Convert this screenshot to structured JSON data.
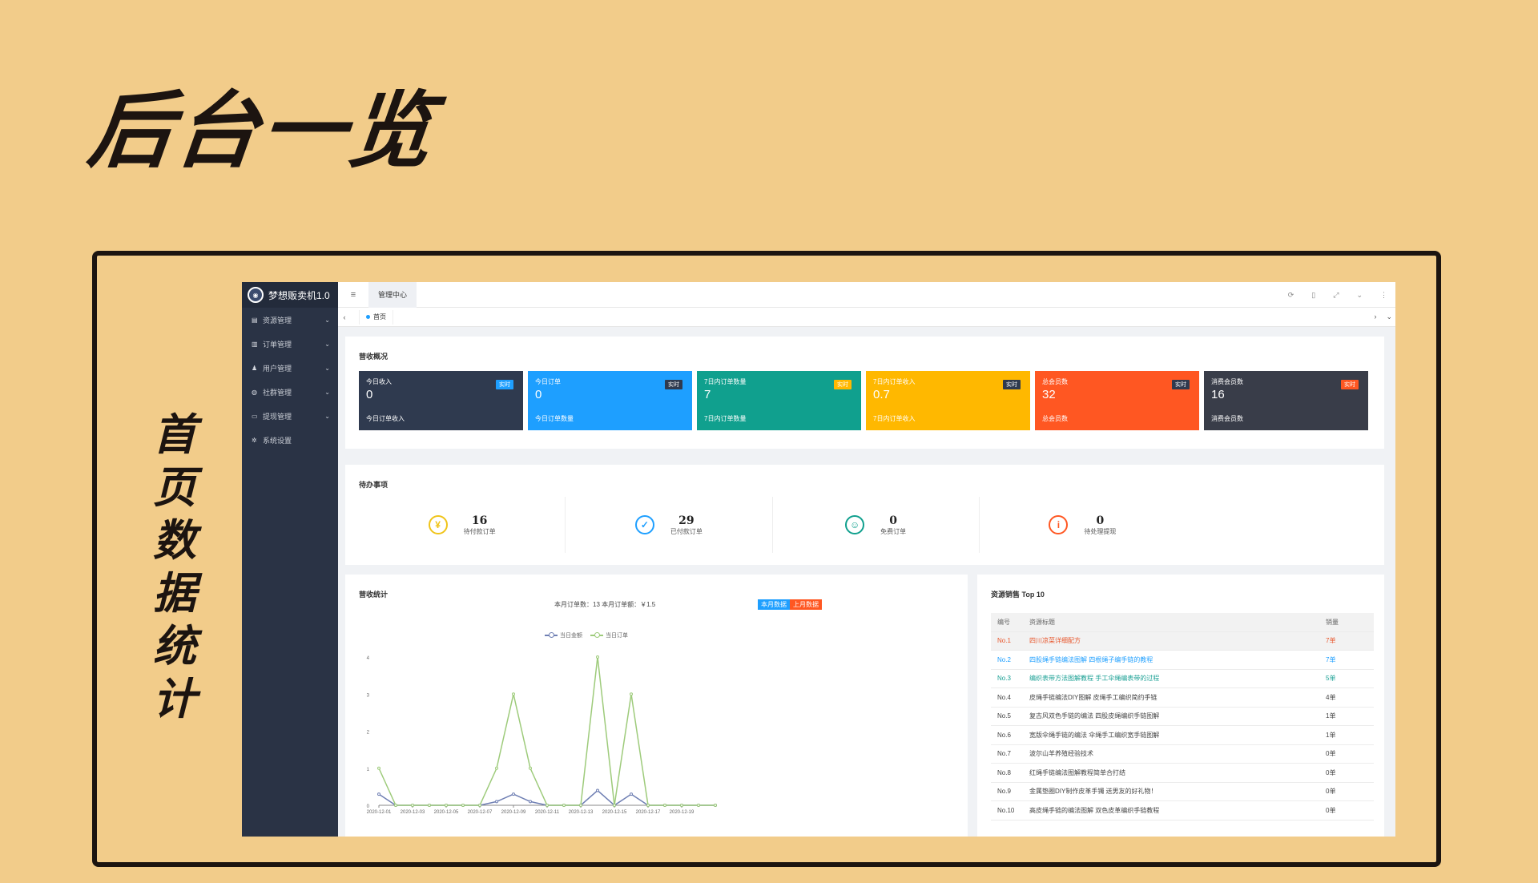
{
  "hero_title": "后台一览",
  "side_caption": [
    "首",
    "页",
    "数",
    "据",
    "统",
    "计"
  ],
  "app": {
    "brand": "梦想贩卖机1.0",
    "sidebar": [
      {
        "label": "资源管理",
        "icon": "file-icon",
        "glyph": "▤",
        "chevron": "⌄"
      },
      {
        "label": "订单管理",
        "icon": "cart-icon",
        "glyph": "▥",
        "chevron": "⌄"
      },
      {
        "label": "用户管理",
        "icon": "users-icon",
        "glyph": "♟",
        "chevron": "⌄"
      },
      {
        "label": "社群管理",
        "icon": "chat-icon",
        "glyph": "◍",
        "chevron": "⌄"
      },
      {
        "label": "提现管理",
        "icon": "card-icon",
        "glyph": "▭",
        "chevron": "⌄"
      },
      {
        "label": "系统设置",
        "icon": "gear-icon",
        "glyph": "✲",
        "chevron": ""
      }
    ],
    "top_tab": "管理中心",
    "home_tab": "首页",
    "icons": {
      "menu": "≡",
      "refresh": "⟳",
      "trash": "🗑",
      "expand": "⤢",
      "dropdown": "⌄",
      "more": "⋮",
      "left": "‹",
      "right": "›"
    }
  },
  "revenue_overview": {
    "title": "营收概况",
    "cards": [
      {
        "name": "今日收入",
        "value": "0",
        "sub": "今日订单收入",
        "badge": "实时",
        "bg": "#2f3a4f",
        "badge_bg": "#1e9fff"
      },
      {
        "name": "今日订单",
        "value": "0",
        "sub": "今日订单数量",
        "badge": "实时",
        "bg": "#1e9fff",
        "badge_bg": "#2f3a4f"
      },
      {
        "name": "7日内订单数量",
        "value": "7",
        "sub": "7日内订单数量",
        "badge": "实时",
        "bg": "#10a08e",
        "badge_bg": "#ffb800"
      },
      {
        "name": "7日内订单收入",
        "value": "0.7",
        "sub": "7日内订单收入",
        "badge": "实时",
        "bg": "#ffb800",
        "badge_bg": "#2f3a4f"
      },
      {
        "name": "总会员数",
        "value": "32",
        "sub": "总会员数",
        "badge": "实时",
        "bg": "#ff5722",
        "badge_bg": "#2f3a4f"
      },
      {
        "name": "消费会员数",
        "value": "16",
        "sub": "消费会员数",
        "badge": "实时",
        "bg": "#393d49",
        "badge_bg": "#ff5722"
      }
    ]
  },
  "todo": {
    "title": "待办事项",
    "items": [
      {
        "icon": "yen-icon",
        "glyph": "¥",
        "color": "#f0c419",
        "value": "16",
        "label": "待付款订单"
      },
      {
        "icon": "shield-icon",
        "glyph": "✓",
        "color": "#1e9fff",
        "value": "29",
        "label": "已付款订单"
      },
      {
        "icon": "smile-icon",
        "glyph": "☺",
        "color": "#10a08e",
        "value": "0",
        "label": "免费订单"
      },
      {
        "icon": "info-icon",
        "glyph": "i",
        "color": "#ff5722",
        "value": "0",
        "label": "待处理提现"
      }
    ]
  },
  "stats": {
    "title": "营收统计",
    "info": "本月订单数：13    本月订单额：￥1.5",
    "btn_this_month": "本月数据",
    "btn_last_month": "上月数据",
    "legend": [
      "当日金额",
      "当日订单"
    ]
  },
  "chart_data": {
    "type": "line",
    "x": [
      "2020-12-01",
      "2020-12-02",
      "2020-12-03",
      "2020-12-04",
      "2020-12-05",
      "2020-12-06",
      "2020-12-07",
      "2020-12-08",
      "2020-12-09",
      "2020-12-10",
      "2020-12-11",
      "2020-12-12",
      "2020-12-13",
      "2020-12-14",
      "2020-12-15",
      "2020-12-16",
      "2020-12-17",
      "2020-12-18",
      "2020-12-19",
      "2020-12-20",
      "2020-12-21"
    ],
    "x_tick_labels": [
      "2020-12-01",
      "2020-12-03",
      "2020-12-05",
      "2020-12-07",
      "2020-12-09",
      "2020-12-11",
      "2020-12-13",
      "2020-12-15",
      "2020-12-17",
      "2020-12-19"
    ],
    "y_ticks": [
      0,
      1,
      2,
      3,
      4
    ],
    "ylim": [
      0,
      4
    ],
    "series": [
      {
        "name": "当日金额",
        "color": "#6f7fb3",
        "values": [
          0.3,
          0,
          0,
          0,
          0,
          0,
          0,
          0.1,
          0.3,
          0.1,
          0,
          0,
          0,
          0.4,
          0,
          0.3,
          0,
          0,
          0,
          0,
          0
        ]
      },
      {
        "name": "当日订单",
        "color": "#9ecb7b",
        "values": [
          1,
          0,
          0,
          0,
          0,
          0,
          0,
          1,
          3,
          1,
          0,
          0,
          0,
          4,
          0,
          3,
          0,
          0,
          0,
          0,
          0
        ]
      }
    ],
    "grid": false
  },
  "top10": {
    "title": "资源销售 Top 10",
    "headers": [
      "编号",
      "资源标题",
      "销量"
    ],
    "rows": [
      {
        "no": "No.1",
        "title": "四川凉菜详细配方",
        "sales": "7单",
        "cls": "t-red",
        "hl": true
      },
      {
        "no": "No.2",
        "title": "四股绳手链编法图解 四根绳子编手链的教程",
        "sales": "7单",
        "cls": "t-blue",
        "hl": false
      },
      {
        "no": "No.3",
        "title": "编织表带方法图解教程 手工伞绳编表带的过程",
        "sales": "5单",
        "cls": "t-teal",
        "hl": false
      },
      {
        "no": "No.4",
        "title": "皮绳手链编法DIY图解 皮绳手工编织简约手链",
        "sales": "4单",
        "cls": "",
        "hl": false
      },
      {
        "no": "No.5",
        "title": "复古风双色手链的编法 四股皮绳编织手链图解",
        "sales": "1单",
        "cls": "",
        "hl": false
      },
      {
        "no": "No.6",
        "title": "宽版伞绳手链的编法 伞绳手工编织宽手链图解",
        "sales": "1单",
        "cls": "",
        "hl": false
      },
      {
        "no": "No.7",
        "title": "波尔山羊养殖经验技术",
        "sales": "0单",
        "cls": "",
        "hl": false
      },
      {
        "no": "No.8",
        "title": "红绳手链编法图解教程简单合打结",
        "sales": "0单",
        "cls": "",
        "hl": false
      },
      {
        "no": "No.9",
        "title": "金属垫圈DIY制作皮革手镯 送男友的好礼物！",
        "sales": "0单",
        "cls": "",
        "hl": false
      },
      {
        "no": "No.10",
        "title": "高皮绳手链的编法图解 双色皮革编织手链教程",
        "sales": "0单",
        "cls": "",
        "hl": false
      }
    ]
  }
}
